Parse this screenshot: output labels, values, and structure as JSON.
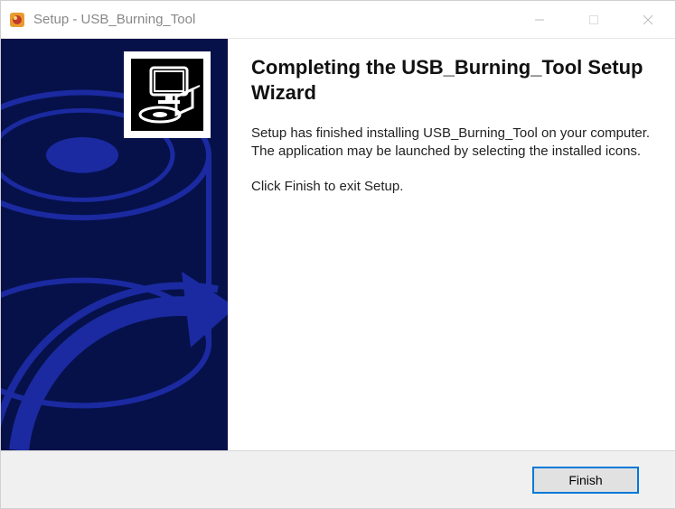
{
  "titlebar": {
    "title": "Setup - USB_Burning_Tool"
  },
  "content": {
    "heading": "Completing the USB_Burning_Tool Setup Wizard",
    "paragraph1": "Setup has finished installing USB_Burning_Tool on your computer. The application may be launched by selecting the installed icons.",
    "paragraph2": "Click Finish to exit Setup."
  },
  "footer": {
    "finish_label": "Finish"
  }
}
